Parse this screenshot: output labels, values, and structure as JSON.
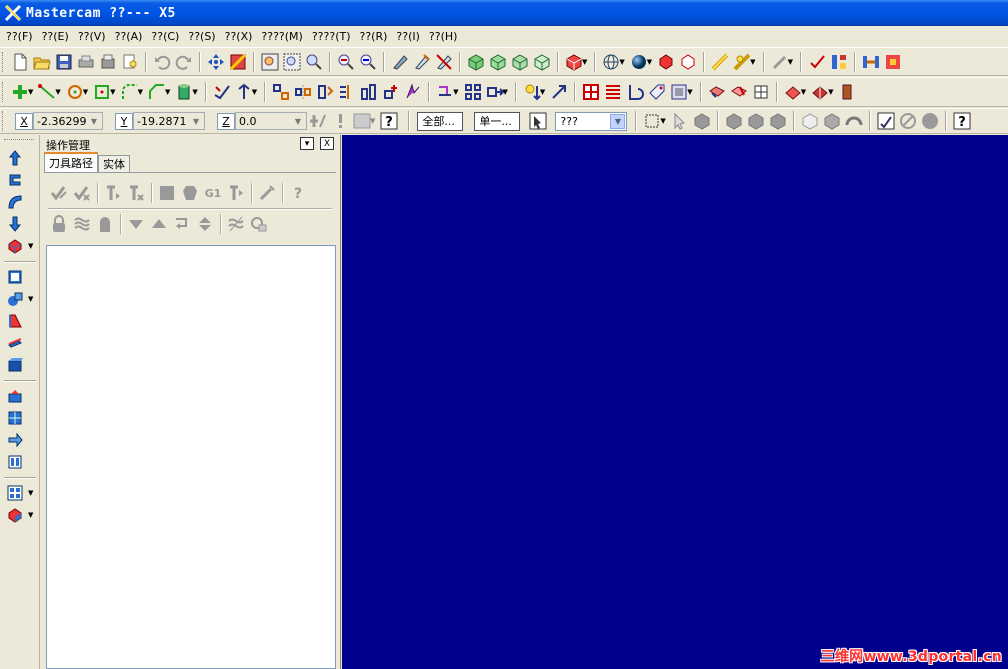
{
  "window": {
    "title": "Mastercam ??--- X5"
  },
  "menu": [
    "??(F)",
    "??(E)",
    "??(V)",
    "??(A)",
    "??(C)",
    "??(S)",
    "??(X)",
    "????(M)",
    "????(T)",
    "??(R)",
    "??(I)",
    "??(H)"
  ],
  "coords": {
    "x_label": "X",
    "x_value": "-2.36299",
    "y_label": "Y",
    "y_value": "-19.2871",
    "z_label": "Z",
    "z_value": "0.0"
  },
  "selection": {
    "all_button": "全部...",
    "single_button": "单一...",
    "filter_value": "???"
  },
  "ops_panel": {
    "title": "操作管理",
    "pin_label": "▾",
    "close_label": "X",
    "tab_toolpaths": "刀具路径",
    "tab_solids": "实体",
    "g1_label": "G1"
  },
  "watermark": "三维网www.3dportal.cn",
  "colors": {
    "viewport_bg": "#00008c",
    "titlebar": "#0054e3"
  }
}
